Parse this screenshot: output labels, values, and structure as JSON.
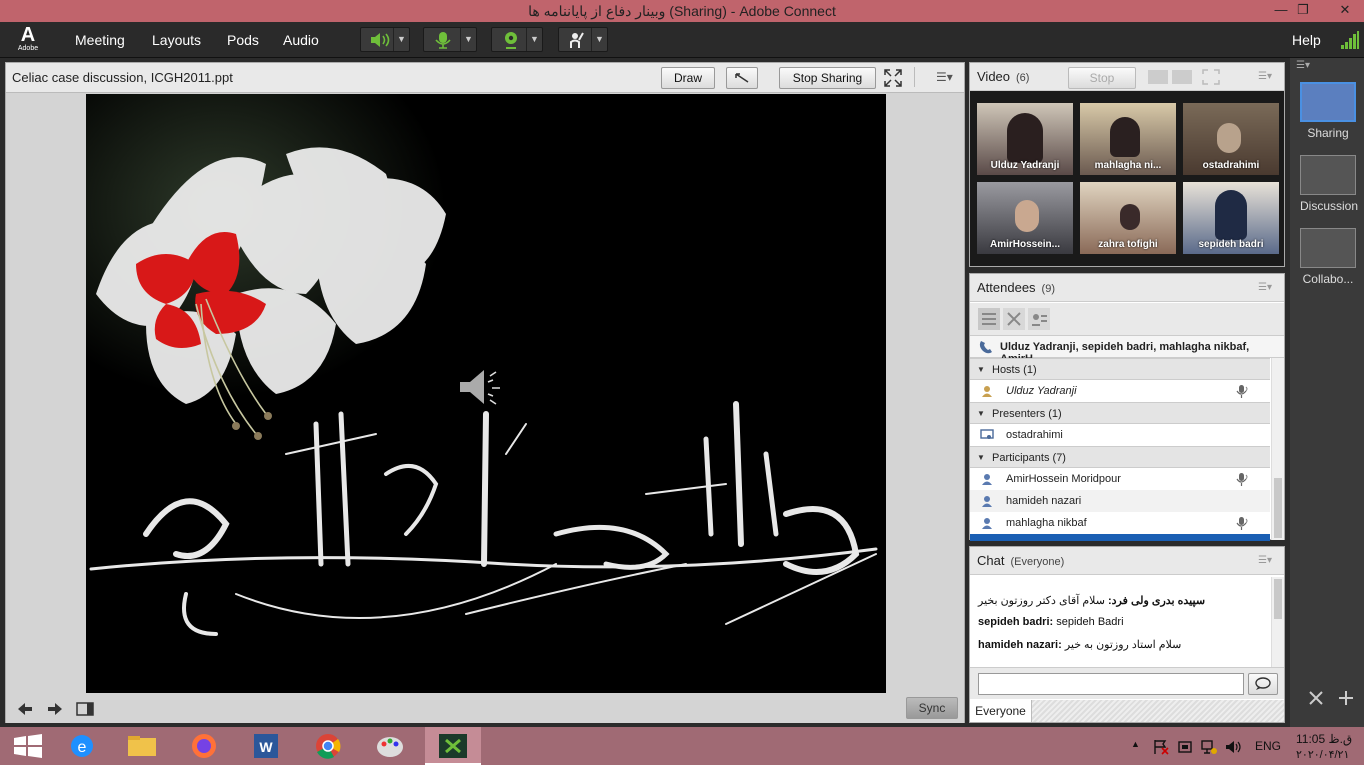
{
  "window": {
    "title": "وبینار دفاع از پایاننامه ها (Sharing) - Adobe Connect",
    "minimize": "—",
    "restore": "❐",
    "close": "✕"
  },
  "logo": {
    "mark": "A",
    "text": "Adobe"
  },
  "menu": {
    "items": [
      "Meeting",
      "Layouts",
      "Pods",
      "Audio"
    ],
    "help": "Help"
  },
  "share": {
    "title": "Celiac case discussion, ICGH2011.ppt",
    "draw": "Draw",
    "stop_sharing": "Stop Sharing",
    "sync": "Sync"
  },
  "video": {
    "title": "Video",
    "count": "(6)",
    "stop": "Stop",
    "tiles": [
      "Ulduz Yadranji",
      "mahlagha ni...",
      "ostadrahimi",
      "AmirHossein...",
      "zahra tofighi",
      "sepideh badri"
    ]
  },
  "attendees": {
    "title": "Attendees",
    "count": "(9)",
    "audio_line": "Ulduz Yadranji, sepideh badri, mahlagha nikbaf, AmirH...",
    "groups": [
      {
        "label": "Hosts (1)",
        "members": [
          "Ulduz Yadranji"
        ]
      },
      {
        "label": "Presenters (1)",
        "members": [
          "ostadrahimi"
        ]
      },
      {
        "label": "Participants (7)",
        "members": [
          "AmirHossein Moridpour",
          "hamideh nazari",
          "mahlagha nikbaf"
        ]
      }
    ]
  },
  "chat": {
    "title": "Chat",
    "scope": "(Everyone)",
    "messages": [
      {
        "sender": "سپیده بدری ولی فرد:",
        "text": "سلام آقای دکتر روزتون بخیر"
      },
      {
        "sender": "sepideh badri:",
        "text": "sepideh Badri"
      },
      {
        "sender": "hamideh nazari:",
        "text": "سلام استاد روزتون به خیر"
      }
    ],
    "tab": "Everyone",
    "input_value": ""
  },
  "layouts": [
    {
      "label": "Sharing"
    },
    {
      "label": "Discussion"
    },
    {
      "label": "Collabo..."
    }
  ],
  "tray": {
    "lang": "ENG",
    "time": "11:05 ق.ظ",
    "date": "۲۰۲۰/۰۴/۲۱"
  },
  "colors": {
    "titlebar": "#c0646c",
    "menubar": "#2a2a2a",
    "taskbar": "#a06a74",
    "accent_green": "#6fbf3a",
    "selected_row": "#1a5fb4"
  }
}
